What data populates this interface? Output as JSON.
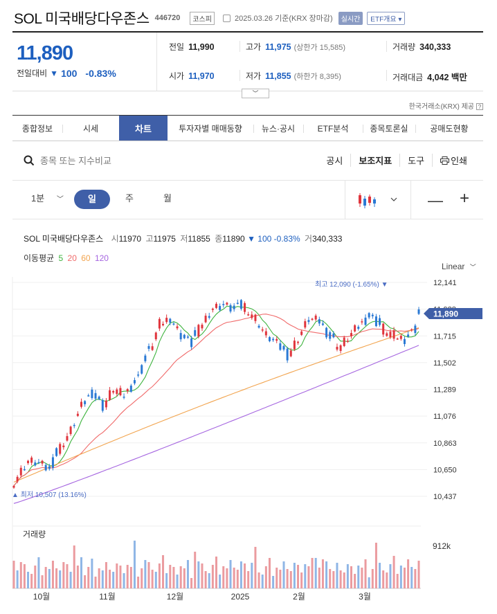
{
  "header": {
    "name": "SOL 미국배당다우존스",
    "code": "446720",
    "market": "코스피",
    "date_text": "2025.03.26 기준(KRX 장마감)",
    "realtime_label": "실시간",
    "etf_label": "ETF개요 ▾"
  },
  "summary": {
    "price": "11,890",
    "change_label": "전일대비",
    "change_arrow": "▼",
    "change_value": "100",
    "change_pct": "-0.83%",
    "prev_close_label": "전일",
    "prev_close": "11,990",
    "high_label": "고가",
    "high": "11,975",
    "upper_limit": "(상한가 15,585)",
    "volume_label": "거래량",
    "volume": "340,333",
    "open_label": "시가",
    "open": "11,970",
    "low_label": "저가",
    "low": "11,855",
    "lower_limit": "(하한가 8,395)",
    "amount_label": "거래대금",
    "amount": "4,042 백만",
    "provider": "한국거래소(KRX) 제공",
    "help_icon": "?"
  },
  "tabs": [
    {
      "label": "종합정보"
    },
    {
      "label": "시세"
    },
    {
      "label": "차트",
      "active": true
    },
    {
      "label": "투자자별 매매동향"
    },
    {
      "label": "뉴스·공시"
    },
    {
      "label": "ETF분석"
    },
    {
      "label": "종목토론실"
    },
    {
      "label": "공매도현황"
    }
  ],
  "toolbar": {
    "search_placeholder": "종목 또는 지수비교",
    "notice_label": "공시",
    "indicator_label": "보조지표",
    "tools_label": "도구",
    "print_label": "인쇄"
  },
  "periods": {
    "minute": "1분",
    "day": "일",
    "week": "주",
    "month": "월"
  },
  "chart_info": {
    "name": "SOL 미국배당다우존스",
    "open_label": "시",
    "open": "11970",
    "high_label": "고",
    "high": "11975",
    "low_label": "저",
    "low": "11855",
    "close_label": "종",
    "close": "11890",
    "change": "▼ 100 -0.83%",
    "vol_label": "거",
    "vol": "340,333",
    "ma_label": "이동평균",
    "ma5": "5",
    "ma20": "20",
    "ma60": "60",
    "ma120": "120",
    "scale_label": "Linear",
    "max_label": "최고 12,090 (-1.65%) ▼",
    "min_label": "▲ 최저 10,507 (13.16%)",
    "volume_title": "거래량",
    "volume_axis": "912k"
  },
  "colors": {
    "up": "#e0353d",
    "down": "#2a79d4",
    "ma5": "#3db33d",
    "ma20": "#f06a6a",
    "ma60": "#f2a44e",
    "ma120": "#a565e0",
    "price_tag": "#3f5fa8"
  },
  "chart_data": {
    "type": "candlestick",
    "yticks": [
      "12,141",
      "11,928",
      "11,715",
      "11,502",
      "11,289",
      "11,076",
      "10,863",
      "10,650",
      "10,437"
    ],
    "ylim": [
      10437,
      12141
    ],
    "current_price_label": "11,890",
    "current_price": 11890,
    "x_labels": [
      "10월",
      "11월",
      "12월",
      "2025",
      "2월",
      "3월"
    ],
    "high_point": 12090,
    "low_point": 10507,
    "ma120_start": 10380,
    "ma120_end": 11640,
    "ma60_start": 10550,
    "ma60_end": 11780,
    "ma60_mid": 11460
  }
}
